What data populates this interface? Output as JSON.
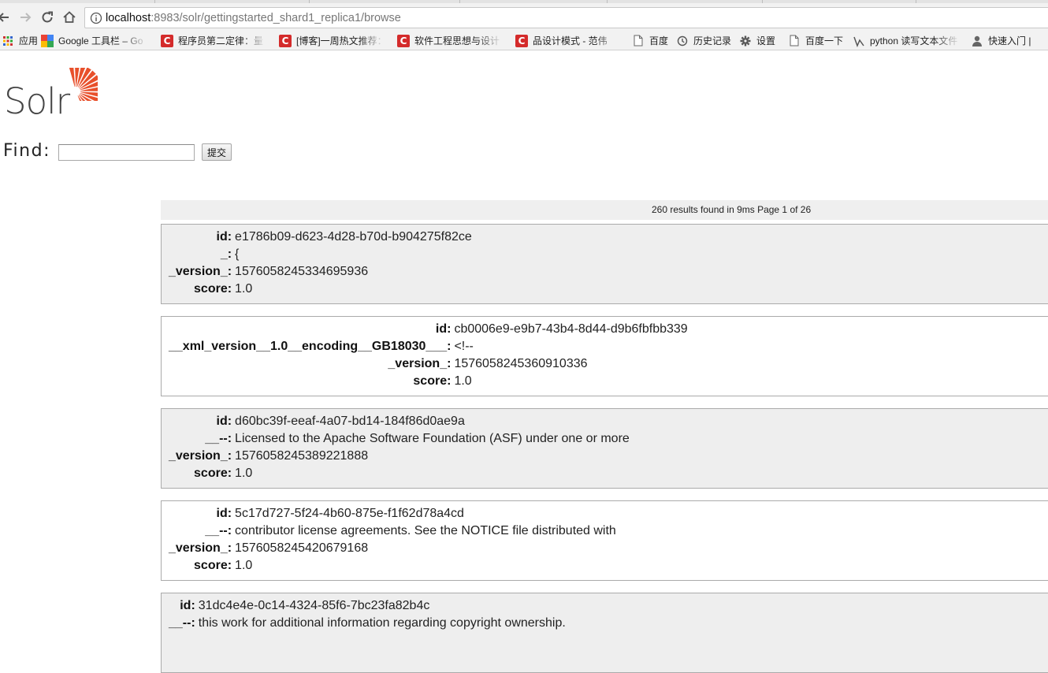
{
  "browser": {
    "url_host": "localhost",
    "url_path": ":8983/solr/gettingstarted_shard1_replica1/browse"
  },
  "bookmarks": [
    {
      "label": "应用",
      "icon": "apps-grid-icon"
    },
    {
      "label": "Google 工具栏 – Go",
      "icon": "google-icon"
    },
    {
      "label": "程序员第二定律：量",
      "icon": "csdn-icon"
    },
    {
      "label": "[博客]一周热文推荐：",
      "icon": "csdn-icon"
    },
    {
      "label": "软件工程思想与设计",
      "icon": "csdn-icon"
    },
    {
      "label": "品设计模式 - 范伟",
      "icon": "csdn-icon"
    },
    {
      "label": "百度",
      "icon": "page-icon"
    },
    {
      "label": "历史记录",
      "icon": "history-icon"
    },
    {
      "label": "设置",
      "icon": "gear-icon"
    },
    {
      "label": "百度一下",
      "icon": "page-icon"
    },
    {
      "label": "python 读写文本文件",
      "icon": "python-icon"
    },
    {
      "label": "快速入门 |",
      "icon": "user-icon"
    }
  ],
  "logo": {
    "text": "Solr"
  },
  "search": {
    "label": "Find:",
    "value": "",
    "submit_label": "提交"
  },
  "results": {
    "summary": "260 results found in 9ms Page 1 of 26"
  },
  "docs": [
    {
      "fields": [
        {
          "key": "id:",
          "value": "e1786b09-d623-4d28-b70d-b904275f82ce"
        },
        {
          "key": "_:",
          "value": "{"
        },
        {
          "key": "_version_:",
          "value": "1576058245334695936"
        },
        {
          "key": "score:",
          "value": "1.0"
        }
      ]
    },
    {
      "fields": [
        {
          "key": "id:",
          "value": "cb0006e9-e9b7-43b4-8d44-d9b6fbfbb339"
        },
        {
          "key": "__xml_version__1.0__encoding__GB18030___:",
          "value": "<!--"
        },
        {
          "key": "_version_:",
          "value": "1576058245360910336"
        },
        {
          "key": "score:",
          "value": "1.0"
        }
      ]
    },
    {
      "fields": [
        {
          "key": "id:",
          "value": "d60bc39f-eeaf-4a07-bd14-184f86d0ae9a"
        },
        {
          "key": "__--:",
          "value": "Licensed to the Apache Software Foundation (ASF) under one or more"
        },
        {
          "key": "_version_:",
          "value": "1576058245389221888"
        },
        {
          "key": "score:",
          "value": "1.0"
        }
      ]
    },
    {
      "fields": [
        {
          "key": "id:",
          "value": "5c17d727-5f24-4b60-875e-f1f62d78a4cd"
        },
        {
          "key": "__--:",
          "value": "contributor license agreements. See the NOTICE file distributed with"
        },
        {
          "key": "_version_:",
          "value": "1576058245420679168"
        },
        {
          "key": "score:",
          "value": "1.0"
        }
      ]
    },
    {
      "fields": [
        {
          "key": "id:",
          "value": "31dc4e4e-0c14-4324-85f6-7bc23fa82b4c"
        },
        {
          "key": "__--:",
          "value": "this work for additional information regarding copyright ownership."
        }
      ]
    }
  ],
  "colors": {
    "logo_orange": "#e8502b",
    "csdn_red": "#d42b2b",
    "doc_odd_bg": "#eeeeee",
    "results_bar_bg": "#efefef"
  }
}
